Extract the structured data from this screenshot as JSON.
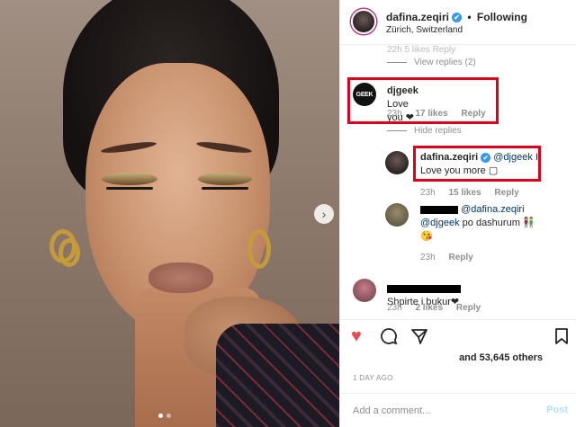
{
  "header": {
    "username": "dafina.zeqiri",
    "verified_mark": "✔",
    "separator": "•",
    "following": "Following",
    "location": "Zürich, Switzerland"
  },
  "comments_top": {
    "cut_off_text": "22h    5 likes    Reply",
    "view_replies": "View replies (2)"
  },
  "comments": [
    {
      "username": "djgeek",
      "avatar_text": "GEEK",
      "text": "Love you ❤",
      "time": "23h",
      "likes": "17 likes",
      "reply": "Reply"
    }
  ],
  "hide_replies": "Hide replies",
  "replies": [
    {
      "username": "dafina.zeqiri",
      "verified_mark": "✔",
      "mention": "@djgeek",
      "text_line1": "I",
      "text_line2": "Love you more ▢",
      "time": "23h",
      "likes": "15 likes",
      "reply": "Reply"
    },
    {
      "mention1": "@dafina.zeqiri",
      "mention2": "@djgeek",
      "text": "po dashurum 👫",
      "text_line3": "😘",
      "time": "23h",
      "reply": "Reply"
    }
  ],
  "comment_bottom": {
    "text": "Shpirte i bukur❤",
    "time": "23h",
    "likes": "2 likes",
    "reply": "Reply"
  },
  "actions": {
    "like_icon": "heart-icon",
    "comment_icon": "comment-icon",
    "share_icon": "share-icon",
    "save_icon": "bookmark-icon"
  },
  "likes_text": "and 53,645 others",
  "posted_time": "1 DAY AGO",
  "add_comment": {
    "placeholder": "Add a comment...",
    "post_label": "Post"
  },
  "colors": {
    "like_red": "#ed4956",
    "highlight_red": "#e0001a",
    "verified_blue": "#3897f0",
    "post_blue": "#b2dffc"
  }
}
